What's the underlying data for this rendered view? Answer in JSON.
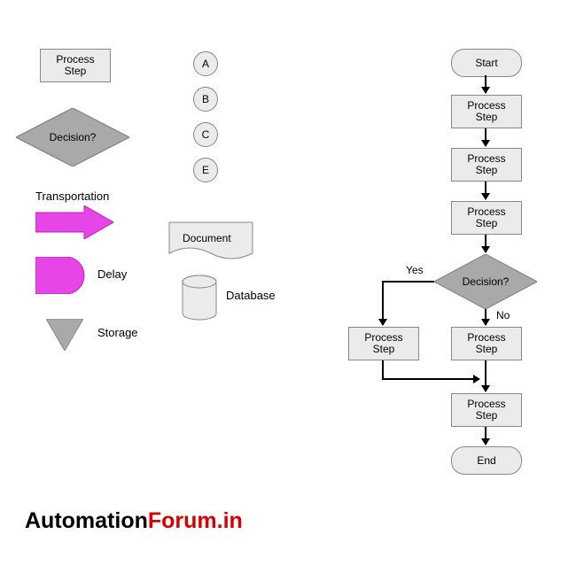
{
  "legend": {
    "process": "Process\nStep",
    "decision": "Decision?",
    "circles": [
      "A",
      "B",
      "C",
      "E"
    ],
    "transportation": "Transportation",
    "delay": "Delay",
    "storage": "Storage",
    "document": "Document",
    "database": "Database"
  },
  "flow": {
    "start": "Start",
    "process_step": "Process\nStep",
    "decision": "Decision?",
    "yes": "Yes",
    "no": "No",
    "end": "End"
  },
  "watermark": {
    "part1": "Automation",
    "part2": "Forum.in"
  },
  "colors": {
    "shape_fill": "#ebebeb",
    "shape_stroke": "#888888",
    "accent": "#e646e6"
  },
  "chart_data": {
    "type": "diagram",
    "title": "Flowchart symbols legend and example flowchart",
    "legend_symbols": [
      {
        "shape": "rectangle",
        "label": "Process Step"
      },
      {
        "shape": "diamond",
        "label": "Decision?"
      },
      {
        "shape": "circle",
        "label": "A"
      },
      {
        "shape": "circle",
        "label": "B"
      },
      {
        "shape": "circle",
        "label": "C"
      },
      {
        "shape": "circle",
        "label": "E"
      },
      {
        "shape": "arrow",
        "label": "Transportation",
        "color": "#e646e6"
      },
      {
        "shape": "delay",
        "label": "Delay",
        "color": "#e646e6"
      },
      {
        "shape": "triangle-down",
        "label": "Storage"
      },
      {
        "shape": "document",
        "label": "Document"
      },
      {
        "shape": "cylinder",
        "label": "Database"
      }
    ],
    "flowchart": {
      "nodes": [
        {
          "id": "start",
          "type": "terminator",
          "label": "Start"
        },
        {
          "id": "p1",
          "type": "process",
          "label": "Process Step"
        },
        {
          "id": "p2",
          "type": "process",
          "label": "Process Step"
        },
        {
          "id": "p3",
          "type": "process",
          "label": "Process Step"
        },
        {
          "id": "d1",
          "type": "decision",
          "label": "Decision?"
        },
        {
          "id": "p4y",
          "type": "process",
          "label": "Process Step"
        },
        {
          "id": "p4n",
          "type": "process",
          "label": "Process Step"
        },
        {
          "id": "p5",
          "type": "process",
          "label": "Process Step"
        },
        {
          "id": "end",
          "type": "terminator",
          "label": "End"
        }
      ],
      "edges": [
        {
          "from": "start",
          "to": "p1"
        },
        {
          "from": "p1",
          "to": "p2"
        },
        {
          "from": "p2",
          "to": "p3"
        },
        {
          "from": "p3",
          "to": "d1"
        },
        {
          "from": "d1",
          "to": "p4y",
          "label": "Yes"
        },
        {
          "from": "d1",
          "to": "p4n",
          "label": "No"
        },
        {
          "from": "p4y",
          "to": "p5"
        },
        {
          "from": "p4n",
          "to": "p5"
        },
        {
          "from": "p5",
          "to": "end"
        }
      ]
    }
  }
}
